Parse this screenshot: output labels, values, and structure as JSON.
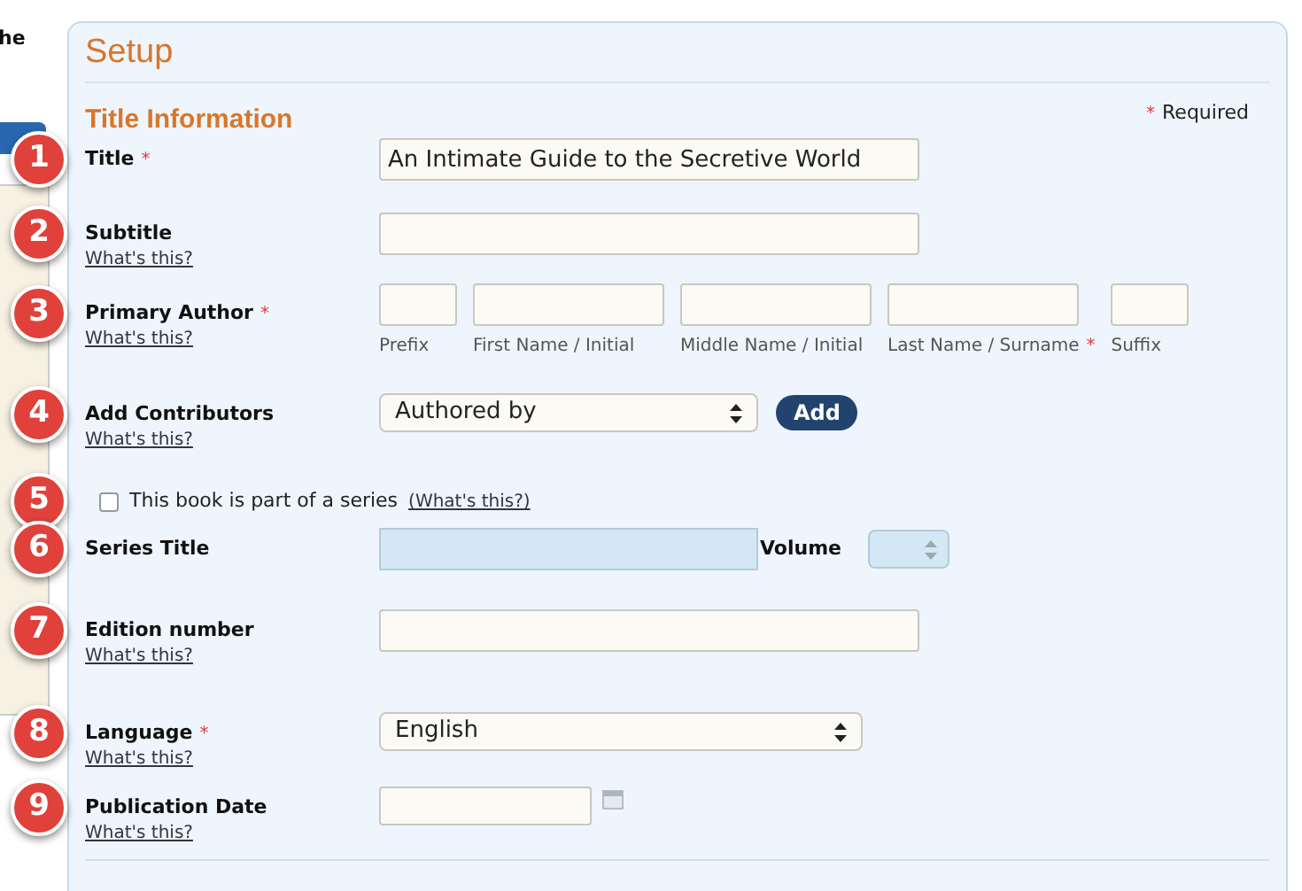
{
  "sidebar": {
    "text": "he"
  },
  "panel": {
    "title": "Setup",
    "section": "Title Information",
    "required_note": "Required",
    "required_mark": "*"
  },
  "rows": [
    {
      "kind": "text",
      "badge": "1",
      "label": "Title",
      "required": true,
      "value": "An Intimate Guide to the Secretive World"
    },
    {
      "kind": "text",
      "badge": "2",
      "label": "Subtitle",
      "required": false,
      "help": "What's this?"
    },
    {
      "kind": "name",
      "badge": "3",
      "label": "Primary Author",
      "required": true,
      "help": "What's this?",
      "parts": [
        {
          "caption": "Prefix",
          "required": false
        },
        {
          "caption": "First Name / Initial",
          "required": false
        },
        {
          "caption": "Middle Name / Initial",
          "required": false
        },
        {
          "caption": "Last Name / Surname",
          "required": true
        },
        {
          "caption": "Suffix",
          "required": false
        }
      ]
    },
    {
      "kind": "select",
      "badge": "4",
      "label": "Add Contributors",
      "required": false,
      "help": "What's this?",
      "value": "Authored by",
      "button": "Add"
    },
    {
      "kind": "checkbox",
      "badge": "5",
      "label": "This book is part of a series",
      "link": "(What's this?)",
      "checked": false
    },
    {
      "kind": "series",
      "badge": "6",
      "label": "Series Title",
      "required": false,
      "disabled": true,
      "volume_label": "Volume"
    },
    {
      "kind": "text",
      "badge": "7",
      "label": "Edition number",
      "required": false,
      "help": "What's this?"
    },
    {
      "kind": "select",
      "badge": "8",
      "label": "Language",
      "required": true,
      "help": "What's this?",
      "value": "English"
    },
    {
      "kind": "date",
      "badge": "9",
      "label": "Publication Date",
      "required": false,
      "help": "What's this?"
    }
  ]
}
